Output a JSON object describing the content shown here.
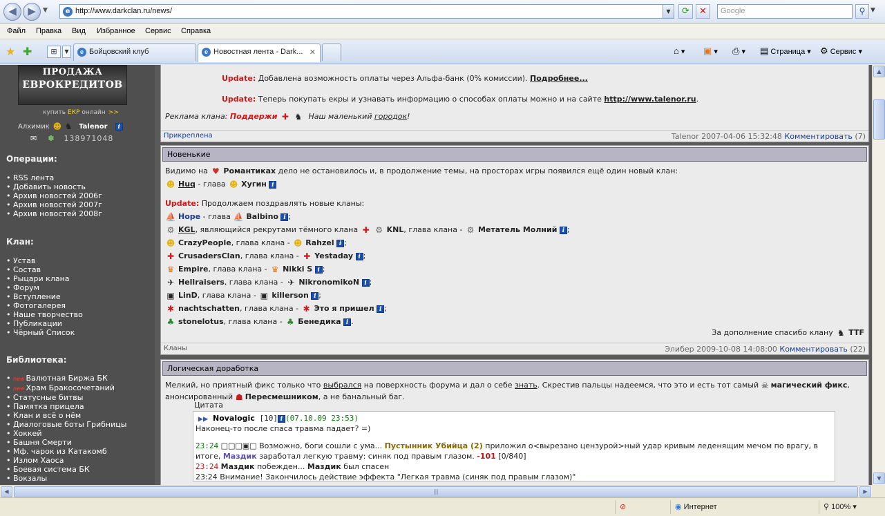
{
  "browser": {
    "url": "http://www.darkclan.ru/news/",
    "search_placeholder": "Google",
    "menu": [
      "Файл",
      "Правка",
      "Вид",
      "Избранное",
      "Сервис",
      "Справка"
    ],
    "tabs": [
      {
        "label": "Бойцовский клуб"
      },
      {
        "label": "Новостная лента - Dark..."
      }
    ],
    "commands": {
      "page": "Страница",
      "tools": "Сервис"
    },
    "status": {
      "zone": "Интернет",
      "zoom": "100%"
    }
  },
  "sidebar": {
    "banner_line1": "ПРОДАЖА",
    "banner_line2": "ЕВРОКРЕДИТОВ",
    "buy_prefix": "купить",
    "buy_ekr": "ЕКР",
    "buy_suffix": "онлайн",
    "buy_arrows": ">>",
    "role": "Алхимик",
    "nick": "Talenor",
    "number": "138971048",
    "operations_title": "Операции:",
    "operations": [
      "RSS лента",
      "Добавить новость",
      "Архив новостей 2006г",
      "Архив новостей 2007г",
      "Архив новостей 2008г"
    ],
    "clan_title": "Клан:",
    "clan_items": [
      "Устав",
      "Состав",
      "Рыцари клана",
      "Форум",
      "Вступление",
      "Фотогалерея",
      "Наше творчество",
      "Публикации",
      "Чёрный Список"
    ],
    "library_title": "Библиотека:",
    "new_tag": "new",
    "library_items": [
      "Валютная Биржа БК",
      "Храм Бракосочетаний",
      "Статусные битвы",
      "Памятка прицела",
      "Клан и всё о нём",
      "Диалоговые боты Грибницы",
      "Хоккей",
      "Башня Смерти",
      "Мф. чарок из Катакомб",
      "Излом Хаоса",
      "Боевая система БК",
      "Вокзалы"
    ]
  },
  "post1": {
    "update_label": "Update:",
    "update1_text": "Добавлена возможность оплаты через Альфа-банк (0% комиссии).",
    "update1_link": "Подробнее...",
    "update2_text": "Теперь покупать екры и узнавать информацию о способах оплаты можно и на сайте",
    "update2_link": "http://www.talenor.ru",
    "ad_prefix": "Реклама клана:",
    "ad_clan": "Поддержи",
    "ad_text": "Наш маленький",
    "ad_link": "городок",
    "ad_end": "!",
    "foot_left": "Прикреплена",
    "foot_author": "Talenor 2007-04-06 15:32:48",
    "foot_comment": "Комментировать",
    "foot_count": "(7)"
  },
  "post2": {
    "title": "Новенькие",
    "intro_a": "Видимо на",
    "intro_clan": "Романтиках",
    "intro_b": "дело не остановилось и, в продолжение темы, на просторах игры появился ещё один новый клан:",
    "huq": "Huq",
    "glava": "- глава",
    "hugin": "Хугин",
    "update_label": "Update:",
    "update_text": "Продолжаем поздравлять новые кланы:",
    "hope": "Hope",
    "balbino": "Balbino",
    "kgl": "KGL",
    "kgl_text": ", являющийся рекрутами тёмного клана",
    "knl": "KNL",
    "glava_clana": ", глава клана -",
    "metatel": "Метатель Молний",
    "clans": [
      {
        "clan": "CrazyPeople",
        "leader": "Rahzel"
      },
      {
        "clan": "CrusadersClan",
        "leader": "Yestaday"
      },
      {
        "clan": "Empire",
        "leader": "Nikki S"
      },
      {
        "clan": "Hellraisers",
        "leader": "NikronomikoN"
      },
      {
        "clan": "LinD",
        "leader": "killerson"
      },
      {
        "clan": "nachtschatten",
        "leader": "Это я пришел"
      },
      {
        "clan": "stonelotus",
        "leader": "Бенедика"
      }
    ],
    "thanks": "За дополнение спасибо клану",
    "thanks_clan": "TTF",
    "foot_left": "Кланы",
    "foot_author": "Элибер 2009-10-08 14:08:00",
    "foot_comment": "Комментировать",
    "foot_count": "(22)"
  },
  "post3": {
    "title": "Логическая доработка",
    "p1_a": "Мелкий, но приятный фикс только что",
    "p1_link1": "выбрался",
    "p1_b": "на поверхность форума и дал о себе",
    "p1_link2": "знать",
    "p1_c": ". Скрестив пальцы надеемся, что это и есть тот самый",
    "p1_bold": "магический фикс",
    "p1_d": ",",
    "p2_a": "анонсированный",
    "p2_bold": "Пересмешником",
    "p2_b": ", а не банальный баг.",
    "quote_label": "Цитата",
    "q_user": "Novalogic",
    "q_level": "[10]",
    "q_date": "(07.10.09 23:53)",
    "q_text": "Наконец-то после спаса травма падает? =)",
    "log1_time": "23:24",
    "log1_boxes": "□□□▣□",
    "log1_a": "Возможно, боги сошли с ума...",
    "log1_name": "Пустынник Убийца (2)",
    "log1_b": "приложил о<вырезано цензурой>ный удар кривым леденящим мечом по врагу, в",
    "log2_a": "итоге,",
    "log2_name": "Маздик",
    "log2_b": "заработал легкую травму: синяк под правым глазом.",
    "log2_dmg": "-101",
    "log2_hp": "[0/840]",
    "log3_time": "23:24",
    "log3_name": "Маздик",
    "log3_a": "побежден...",
    "log3_name2": "Маздик",
    "log3_b": "был спасен",
    "log4": "23:24 Внимание! Закончилось действие эффекта \"Легкая травма (синяк под правым глазом)\""
  }
}
